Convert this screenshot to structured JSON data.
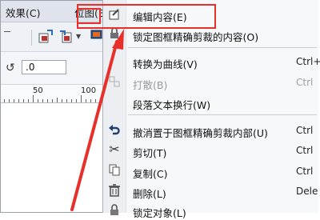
{
  "menubar": {
    "effects": "效果(C)",
    "bitmap": "位图(B)"
  },
  "toolbar": {
    "rotation_value": ".0"
  },
  "ruler": {
    "labels": [
      "50",
      "100"
    ]
  },
  "context_menu": {
    "items": [
      {
        "label": "编辑内容(E)",
        "shortcut": "",
        "icon": "edit-contents-icon"
      },
      {
        "label": "锁定图框精确剪裁的内容(O)",
        "shortcut": "",
        "icon": "lock-icon"
      },
      {
        "label": "转换为曲线(V)",
        "shortcut": "Ctrl+",
        "icon": ""
      },
      {
        "label": "打散(B)",
        "shortcut": "Ctrl",
        "icon": "break-apart-icon",
        "disabled": true
      },
      {
        "label": "段落文本换行(W)",
        "shortcut": "",
        "icon": ""
      },
      {
        "label": "撤消置于图框精确剪裁内部(U)",
        "shortcut": "Ctrl",
        "icon": "undo-icon"
      },
      {
        "label": "剪切(T)",
        "shortcut": "Ctrl",
        "icon": "scissors-icon"
      },
      {
        "label": "复制(C)",
        "shortcut": "Ctrl",
        "icon": "copy-icon"
      },
      {
        "label": "删除(L)",
        "shortcut": "Dele",
        "icon": "trash-icon"
      },
      {
        "label": "锁定对象(L)",
        "shortcut": "",
        "icon": "lock-object-icon"
      }
    ]
  },
  "annotation": {
    "color": "#e8302b"
  }
}
